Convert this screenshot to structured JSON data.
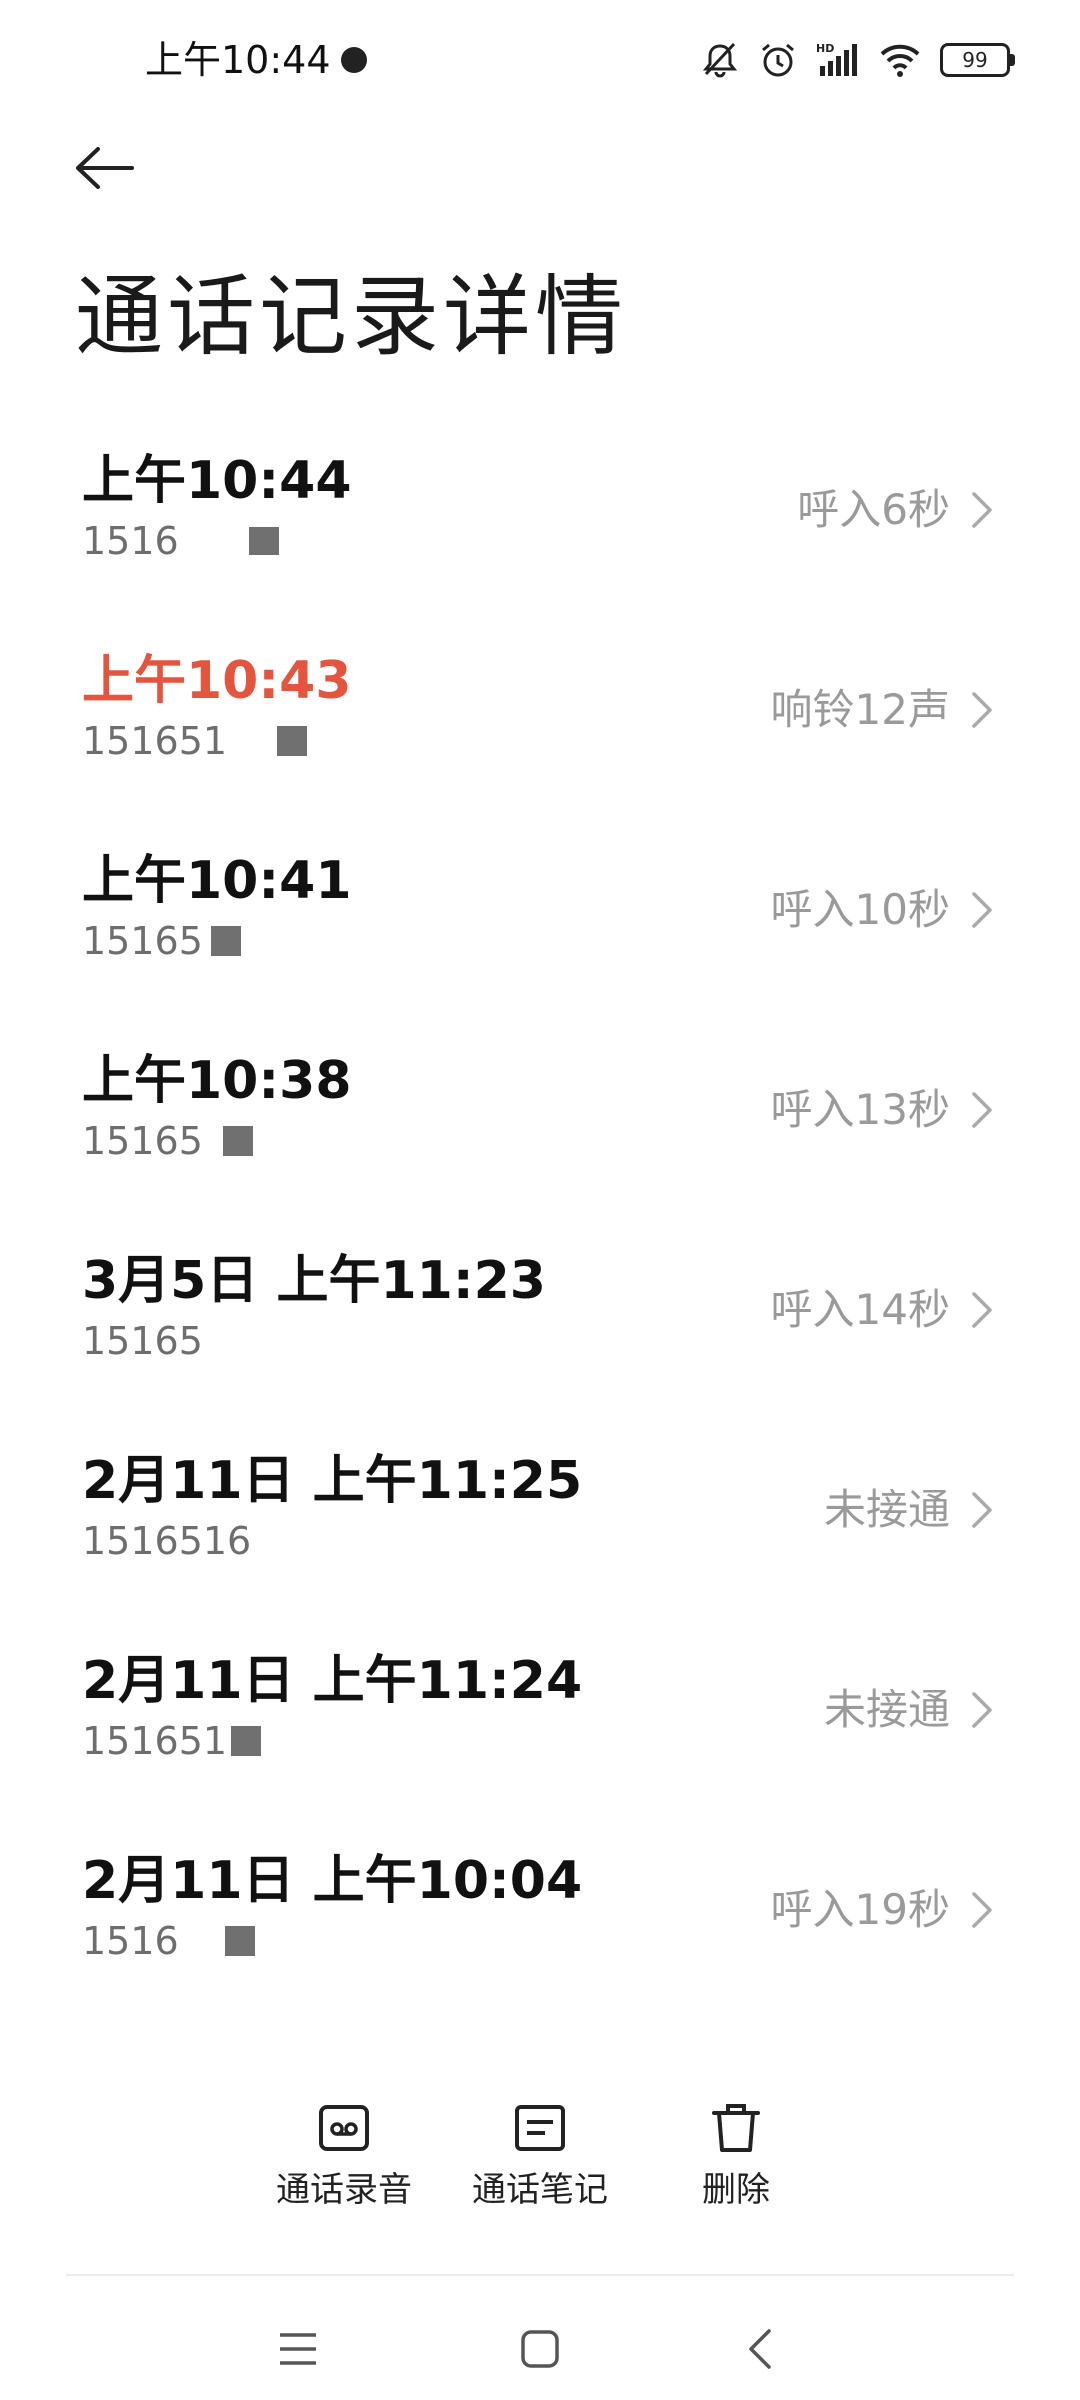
{
  "status_bar": {
    "time": "上午10:44",
    "battery": "99",
    "icons": [
      "mute-bell-icon",
      "alarm-icon",
      "hd-signal-icon",
      "wifi-icon",
      "battery-icon"
    ]
  },
  "header": {
    "back_icon": "arrow-left-icon",
    "title": "通话记录详情"
  },
  "records": [
    {
      "time": "上午10:44",
      "number": "1516",
      "status": "呼入6秒",
      "missed": false
    },
    {
      "time": "上午10:43",
      "number": "151651",
      "status": "响铃12声",
      "missed": true
    },
    {
      "time": "上午10:41",
      "number": "15165",
      "status": "呼入10秒",
      "missed": false
    },
    {
      "time": "上午10:38",
      "number": "15165",
      "status": "呼入13秒",
      "missed": false
    },
    {
      "time": "3月5日 上午11:23",
      "number": "15165",
      "status": "呼入14秒",
      "missed": false
    },
    {
      "time": "2月11日 上午11:25",
      "number": "1516516",
      "status": "未接通",
      "missed": false
    },
    {
      "time": "2月11日 上午11:24",
      "number": "151651",
      "status": "未接通",
      "missed": false
    },
    {
      "time": "2月11日 上午10:04",
      "number": "1516",
      "status": "呼入19秒",
      "missed": false
    }
  ],
  "colors": {
    "missed": "#e4553f",
    "status_text": "#9a9a9a",
    "number_text": "#6e6e6e"
  },
  "actions": [
    {
      "label": "通话录音",
      "icon": "recording-icon"
    },
    {
      "label": "通话笔记",
      "icon": "note-icon"
    },
    {
      "label": "删除",
      "icon": "trash-icon"
    }
  ],
  "nav": {
    "icons": [
      "menu-icon",
      "home-icon",
      "back-icon"
    ]
  }
}
